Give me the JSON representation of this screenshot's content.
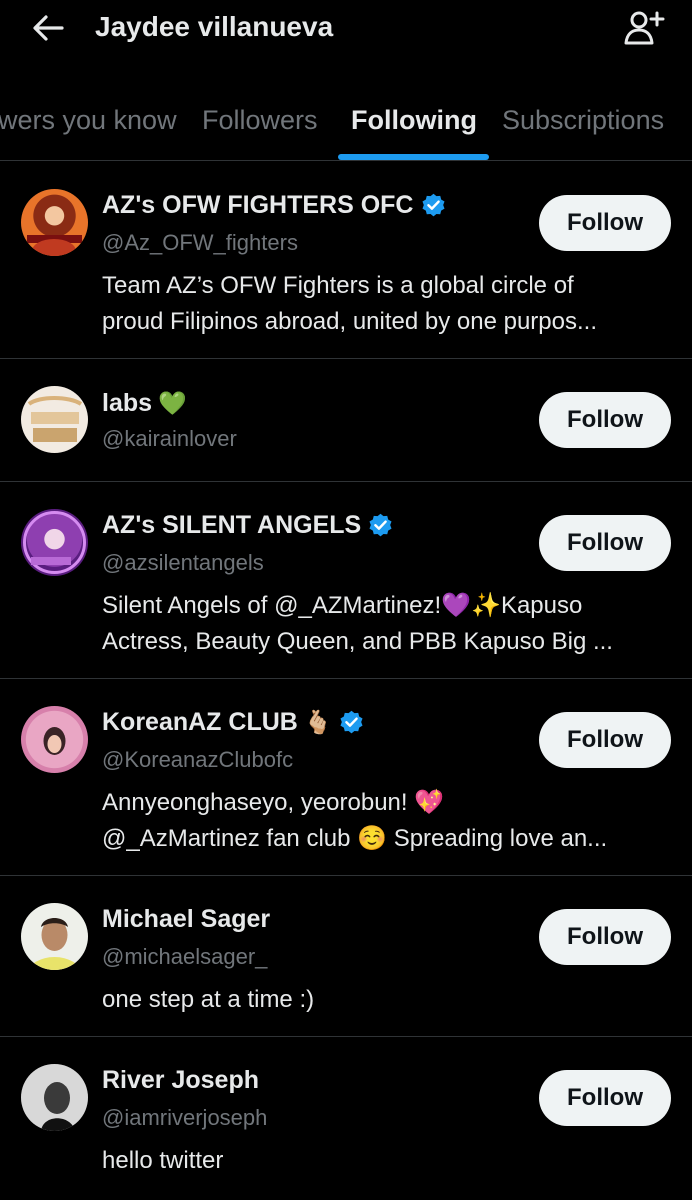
{
  "header": {
    "title": "Jaydee villanueva",
    "back_icon": "arrow-left-icon",
    "follow_icon": "person-plus-icon"
  },
  "tabs": [
    {
      "label": "wers you know",
      "active": false
    },
    {
      "label": "Followers",
      "active": false
    },
    {
      "label": "Following",
      "active": true
    },
    {
      "label": "Subscriptions",
      "active": false
    }
  ],
  "colors": {
    "accent": "#1d9bf0",
    "background": "#000000",
    "text_primary": "#e7e9ea",
    "text_secondary": "#71767b",
    "button_bg": "#eff3f4"
  },
  "users": [
    {
      "name": "AZ's OFW FIGHTERS OFC",
      "verified": true,
      "name_emoji": "",
      "handle": "@Az_OFW_fighters",
      "bio_lines": [
        "Team AZ’s OFW Fighters is a global circle of",
        "proud Filipinos abroad, united by one purpos..."
      ],
      "button": "Follow"
    },
    {
      "name": "labs",
      "verified": false,
      "name_emoji": "💚",
      "handle": "@kairainlover",
      "bio_lines": [],
      "button": "Follow"
    },
    {
      "name": "AZ's SILENT ANGELS",
      "verified": true,
      "name_emoji": "",
      "handle": "@azsilentangels",
      "bio_lines": [
        "Silent Angels of @_AZMartinez!💜✨Kapuso",
        "Actress, Beauty Queen, and PBB Kapuso Big ..."
      ],
      "button": "Follow"
    },
    {
      "name": "KoreanAZ CLUB",
      "verified": true,
      "name_emoji": "🫰🏼",
      "handle": "@KoreanazClubofc",
      "bio_lines": [
        "Annyeonghaseyo, yeorobun! 💖",
        "@_AzMartinez fan club ☺️ Spreading love an..."
      ],
      "button": "Follow"
    },
    {
      "name": "Michael Sager",
      "verified": false,
      "name_emoji": "",
      "handle": "@michaelsager_",
      "bio_lines": [
        "one step at a time :)"
      ],
      "button": "Follow"
    },
    {
      "name": "River Joseph",
      "verified": false,
      "name_emoji": "",
      "handle": "@iamriverjoseph",
      "bio_lines": [
        "hello twitter"
      ],
      "button": "Follow"
    }
  ]
}
